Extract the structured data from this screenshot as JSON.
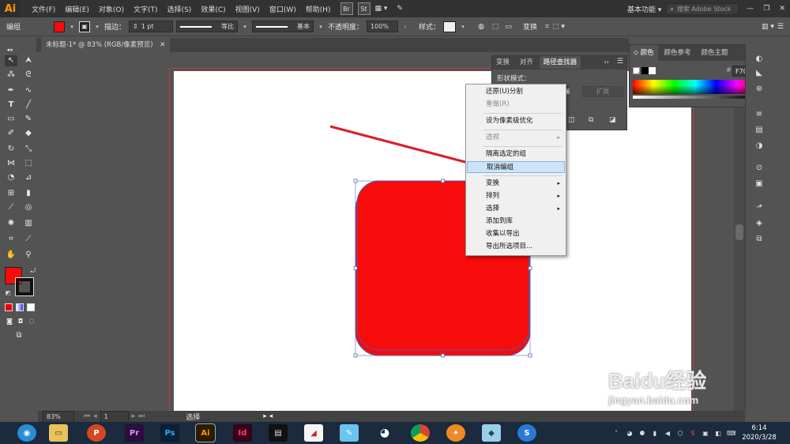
{
  "app": {
    "logo": "Ai"
  },
  "menu": [
    "文件(F)",
    "编辑(E)",
    "对象(O)",
    "文字(T)",
    "选择(S)",
    "效果(C)",
    "视图(V)",
    "窗口(W)",
    "帮助(H)"
  ],
  "bridge_icons": [
    "Br",
    "St"
  ],
  "workspace": {
    "label": "基本功能",
    "search_placeholder": "搜索 Adobe Stock"
  },
  "control_bar": {
    "selection_label": "编组",
    "fill_color": "#F70B0B",
    "stroke_label": "描边：",
    "stroke_weight": "1 pt",
    "profile_label": "等比",
    "brush_label": "基本",
    "opacity_label": "不透明度：",
    "opacity_value": "100%",
    "style_label": "样式：",
    "transform_label": "变换"
  },
  "document_tab": {
    "title": "未标题-1* @ 83% (RGB/像素预览)"
  },
  "pathfinder_panel": {
    "tabs": [
      "变换",
      "对齐",
      "路径查找器"
    ],
    "shape_modes_label": "形状模式：",
    "expand_label": "扩展"
  },
  "color_panel": {
    "tabs": [
      "颜色",
      "颜色参考",
      "颜色主题"
    ],
    "hex_label": "#",
    "hex_value": "F70B0B"
  },
  "context_menu": {
    "items": [
      {
        "label": "还原(U)分割",
        "enabled": true,
        "submenu": false
      },
      {
        "label": "重做(R)",
        "enabled": false,
        "submenu": false
      },
      {
        "label": "设为像素级优化",
        "enabled": true,
        "submenu": false
      },
      {
        "label": "透视",
        "enabled": false,
        "submenu": true
      },
      {
        "label": "隔离选定的组",
        "enabled": true,
        "submenu": false
      },
      {
        "label": "取消编组",
        "enabled": true,
        "submenu": false,
        "highlighted": true
      },
      {
        "label": "变换",
        "enabled": true,
        "submenu": true
      },
      {
        "label": "排列",
        "enabled": true,
        "submenu": true
      },
      {
        "label": "选择",
        "enabled": true,
        "submenu": true
      },
      {
        "label": "添加到库",
        "enabled": true,
        "submenu": false
      },
      {
        "label": "收集以导出",
        "enabled": true,
        "submenu": false
      },
      {
        "label": "导出所选项目...",
        "enabled": true,
        "submenu": false
      }
    ]
  },
  "artwork": {
    "shape_color": "#F70B0B",
    "arrow_color": "#D9202A"
  },
  "status_bar": {
    "zoom": "83%",
    "page": "1",
    "tool": "选择"
  },
  "taskbar": {
    "apps": [
      "P",
      "Pr",
      "Ps",
      "Ai",
      "Id"
    ],
    "time": "6:14",
    "date": "2020/3/28"
  },
  "watermark": {
    "brand": "Baidu经验",
    "url": "jingyan.baidu.com"
  }
}
